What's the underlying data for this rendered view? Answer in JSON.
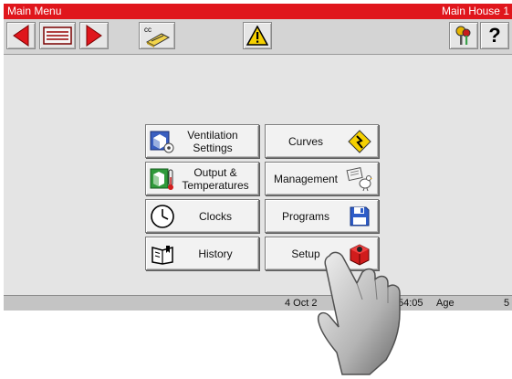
{
  "titlebar": {
    "title": "Main Menu",
    "house": "Main House 1"
  },
  "toolbar": {
    "help_label": "?",
    "cc_label": "cc"
  },
  "menu": {
    "ventilation": "Ventilation Settings",
    "curves": "Curves",
    "output": "Output & Temperatures",
    "management": "Management",
    "clocks": "Clocks",
    "programs": "Programs",
    "history": "History",
    "setup": "Setup"
  },
  "status": {
    "date": "4 Oct 2",
    "time": "54:05",
    "age_label": "Age",
    "age_value": "5"
  },
  "colors": {
    "title_red": "#e0161c",
    "arrow_red": "#e0161c",
    "warning_yellow": "#f5d000"
  },
  "icons": [
    "arrow-left-icon",
    "list-icon",
    "arrow-right-icon",
    "cc-card-icon",
    "warning-icon",
    "keys-icon",
    "help-icon",
    "ventilation-icon",
    "curves-icon",
    "output-temperature-icon",
    "management-icon",
    "clock-icon",
    "programs-disk-icon",
    "history-book-icon",
    "setup-icon",
    "pointing-hand-icon"
  ]
}
